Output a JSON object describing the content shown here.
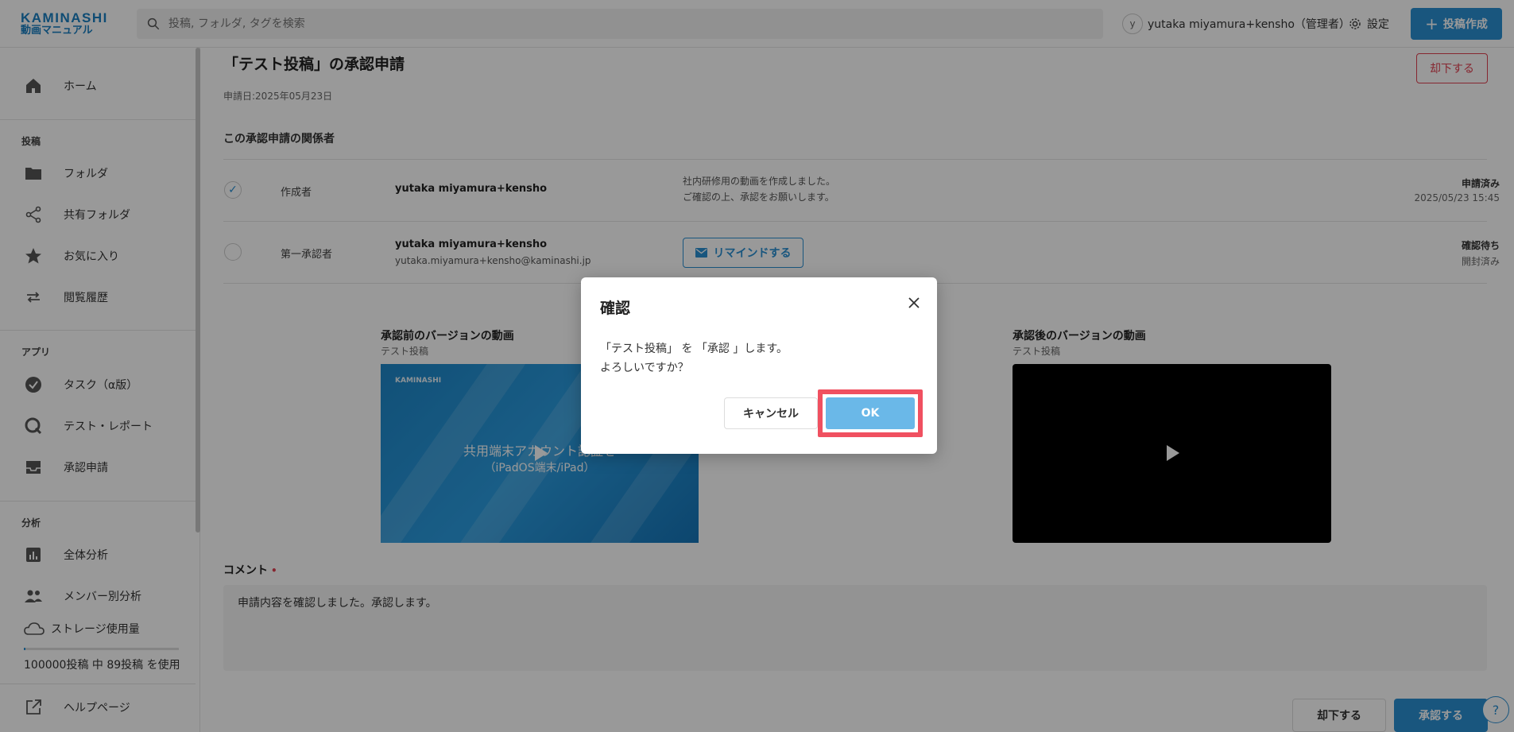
{
  "header": {
    "logo_line1": "KAMINASHI",
    "logo_line2": "動画マニュアル",
    "search_placeholder": "投稿, フォルダ, タグを検索",
    "avatar_initial": "y",
    "user_name": "yutaka miyamura+kensho（管理者）",
    "settings_label": "設定",
    "create_label": "投稿作成"
  },
  "sidebar": {
    "home": "ホーム",
    "section_posts": "投稿",
    "folder": "フォルダ",
    "shared_folder": "共有フォルダ",
    "favorites": "お気に入り",
    "history": "閲覧履歴",
    "section_apps": "アプリ",
    "task": "タスク（α版）",
    "test_report": "テスト・レポート",
    "approval": "承認申請",
    "section_analytics": "分析",
    "overall_analysis": "全体分析",
    "member_analysis": "メンバー別分析",
    "storage_label": "ストレージ使用量",
    "storage_text": "100000投稿 中 89投稿 を使用",
    "help_page": "ヘルプページ"
  },
  "main": {
    "title": "「テスト投稿」の承認申請",
    "date": "申請日:2025年05月23日",
    "reject_label": "却下する",
    "section_title": "この承認申請の関係者",
    "rows": [
      {
        "role": "作成者",
        "name": "yutaka miyamura+kensho",
        "message_line1": "社内研修用の動画を作成しました。",
        "message_line2": "ご確認の上、承認をお願いします。",
        "status": "申請済み",
        "status_sub": "2025/05/23 15:45"
      },
      {
        "role": "第一承認者",
        "name": "yutaka miyamura+kensho",
        "email": "yutaka.miyamura+kensho@kaminashi.jp",
        "remind_label": "リマインドする",
        "status": "確認待ち",
        "status_sub": "開封済み"
      }
    ],
    "before_label": "承認前のバージョンの動画",
    "before_sub": "テスト投稿",
    "before_thumb_brand": "KAMINASHI",
    "before_thumb_line1": "共用端末アカウント認証を",
    "before_thumb_line2": "（iPadOS端末/iPad）",
    "after_label": "承認後のバージョンの動画",
    "after_sub": "テスト投稿",
    "comment_label": "コメント",
    "comment_required": "•",
    "comment_text": "申請内容を確認しました。承認します。",
    "reject_bottom": "却下する",
    "approve_bottom": "承認する",
    "help": "?"
  },
  "modal": {
    "title": "確認",
    "body_line1": "「テスト投稿」 を 「承認 」します。",
    "body_line2": "よろしいですか？",
    "cancel_label": "キャンセル",
    "ok_label": "OK"
  }
}
